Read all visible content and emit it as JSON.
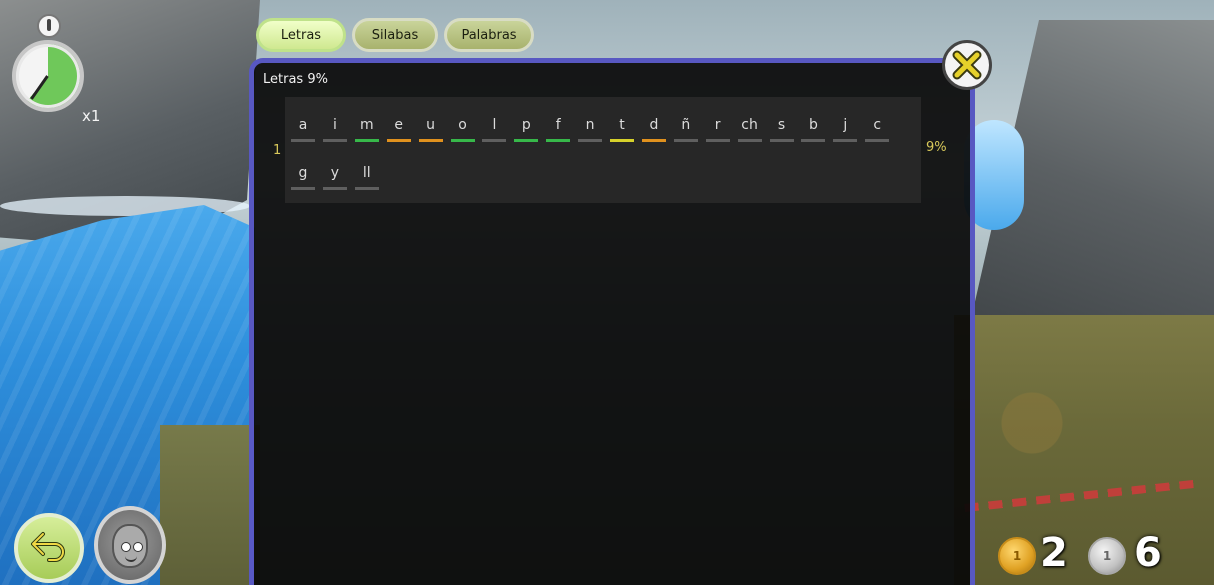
{
  "tabs": [
    {
      "label": "Letras",
      "active": true
    },
    {
      "label": "Silabas",
      "active": false
    },
    {
      "label": "Palabras",
      "active": false
    }
  ],
  "stopwatch": {
    "multiplier": "x1",
    "fill_fraction": 0.6
  },
  "panel": {
    "title": "Letras 9%",
    "row_number": "1",
    "row_percent": "9%",
    "border_color": "#5858c2"
  },
  "letters_row1": [
    {
      "char": "a",
      "status": "none"
    },
    {
      "char": "i",
      "status": "none"
    },
    {
      "char": "m",
      "status": "green"
    },
    {
      "char": "e",
      "status": "orange"
    },
    {
      "char": "u",
      "status": "orange"
    },
    {
      "char": "o",
      "status": "green"
    },
    {
      "char": "l",
      "status": "none"
    },
    {
      "char": "p",
      "status": "green"
    },
    {
      "char": "f",
      "status": "green"
    },
    {
      "char": "n",
      "status": "none"
    },
    {
      "char": "t",
      "status": "yellow"
    },
    {
      "char": "d",
      "status": "orange"
    },
    {
      "char": "ñ",
      "status": "none"
    },
    {
      "char": "r",
      "status": "none"
    },
    {
      "char": "ch",
      "status": "none"
    },
    {
      "char": "s",
      "status": "none"
    },
    {
      "char": "b",
      "status": "none"
    },
    {
      "char": "j",
      "status": "none"
    },
    {
      "char": "c",
      "status": "none"
    }
  ],
  "letters_row2": [
    {
      "char": "g",
      "status": "none"
    },
    {
      "char": "y",
      "status": "none"
    },
    {
      "char": "ll",
      "status": "none"
    }
  ],
  "coins": {
    "gold": {
      "label": "1",
      "count": "2"
    },
    "silver": {
      "label": "1",
      "count": "6"
    }
  },
  "icons": {
    "close": "close-x-icon",
    "back": "back-arrow-icon",
    "avatar": "avatar-icon",
    "stopwatch": "stopwatch-icon"
  }
}
